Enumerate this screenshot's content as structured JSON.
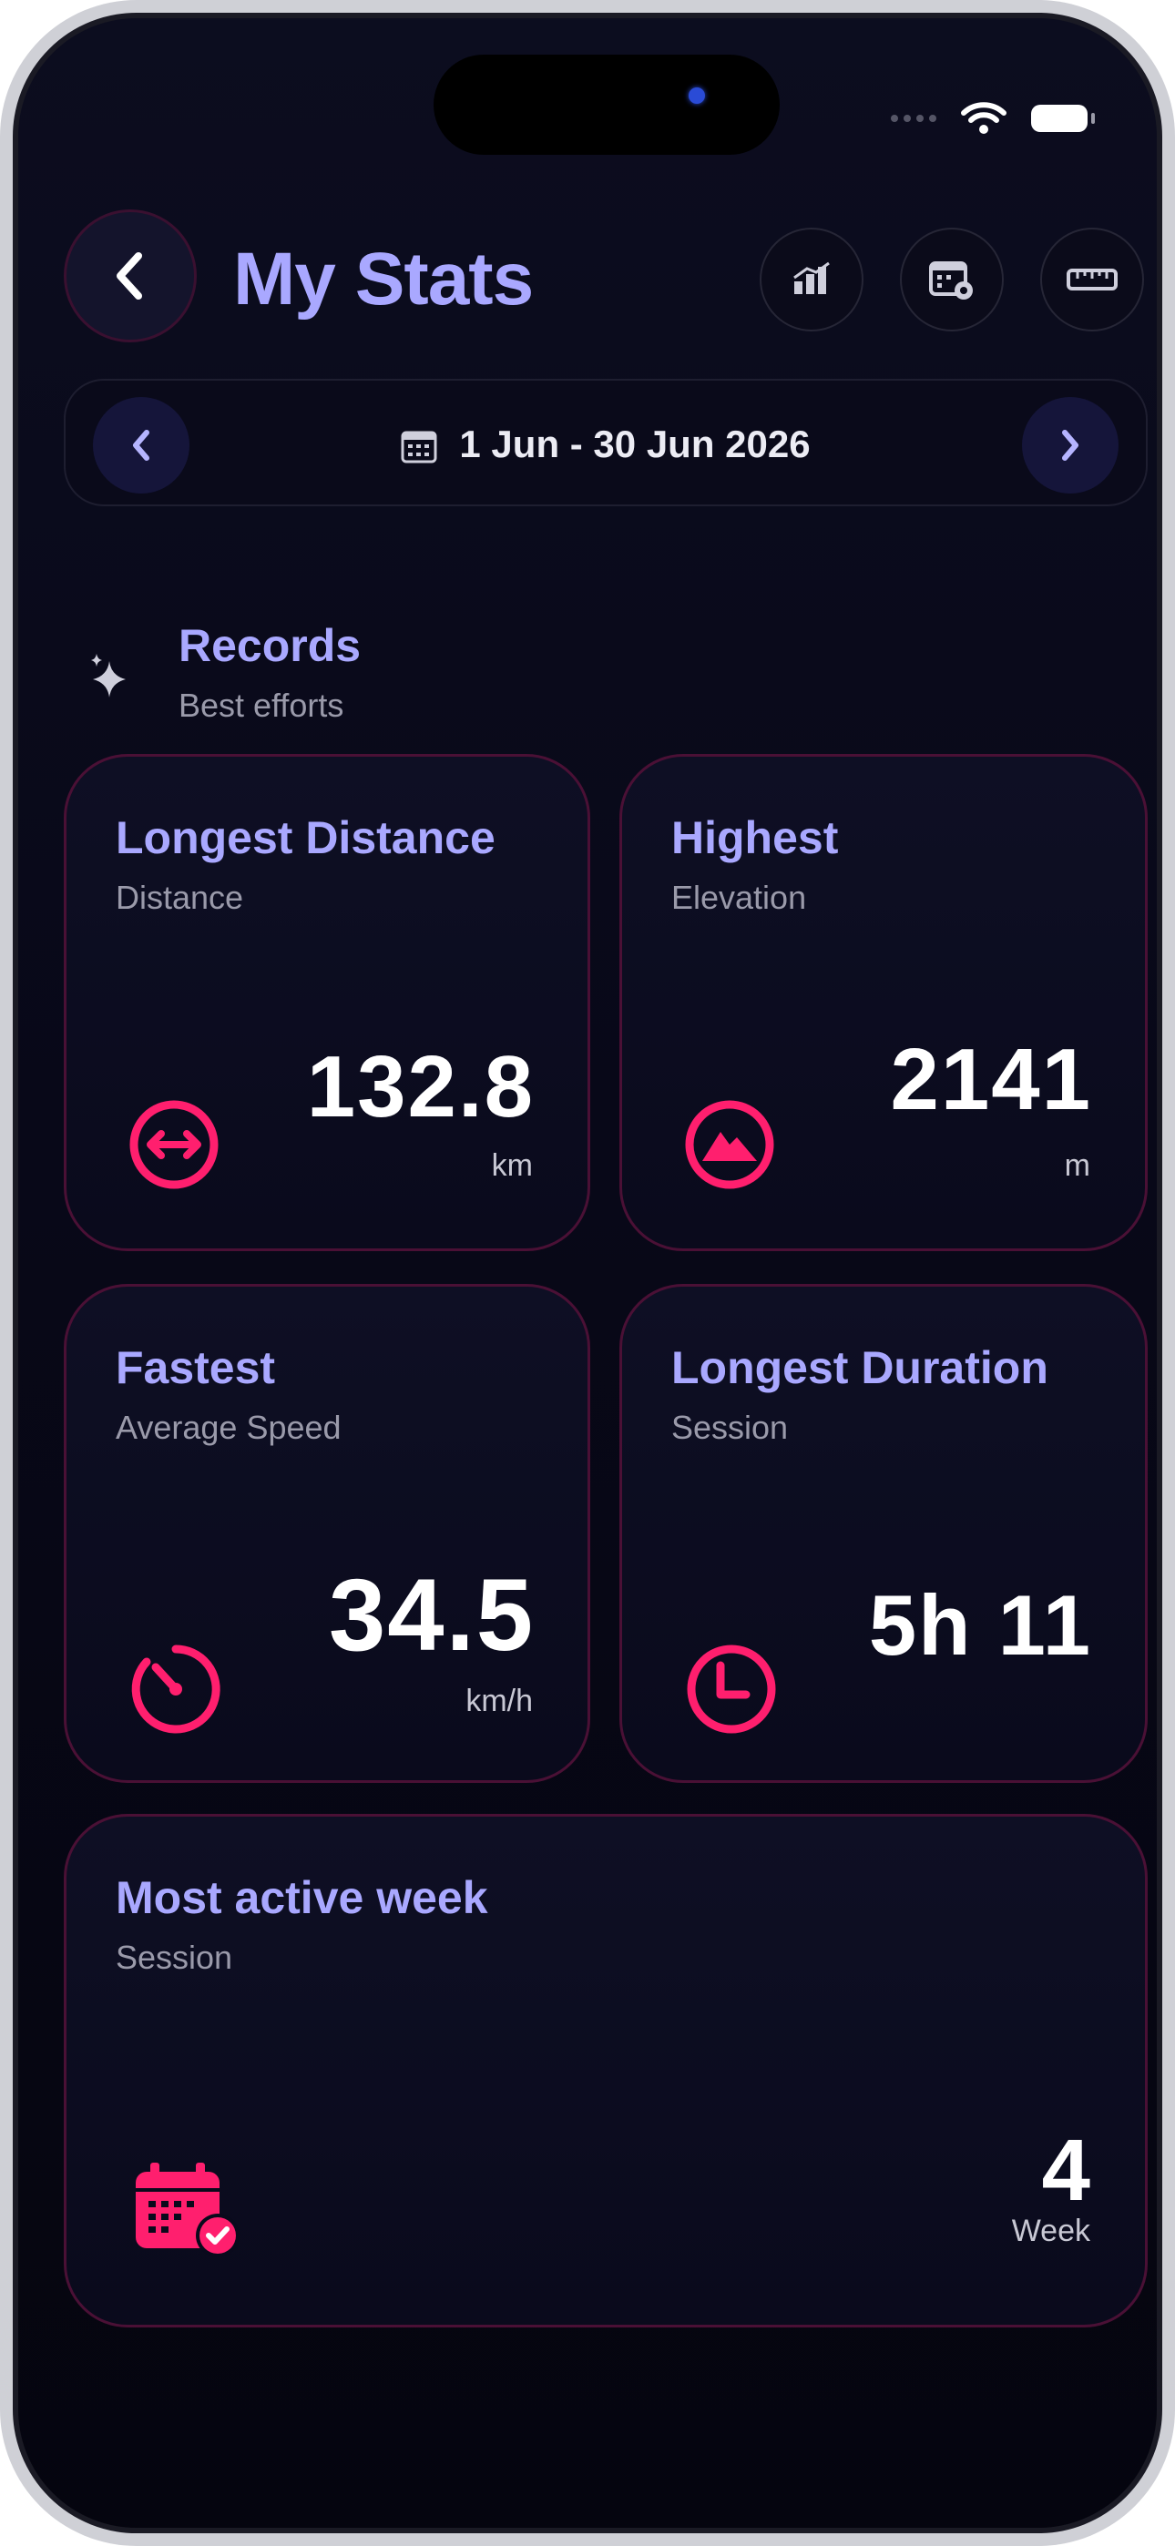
{
  "header": {
    "title": "My Stats"
  },
  "date_range": {
    "label": "1 Jun - 30 Jun 2026"
  },
  "records": {
    "title": "Records",
    "subtitle": "Best efforts"
  },
  "cards": [
    {
      "title": "Longest Distance",
      "subtitle": "Distance",
      "value": "132.8",
      "unit": "km",
      "icon": "distance-arrows-icon"
    },
    {
      "title": "Highest",
      "subtitle": "Elevation",
      "value": "2141",
      "unit": "m",
      "icon": "mountain-icon"
    },
    {
      "title": "Fastest",
      "subtitle": "Average Speed",
      "value": "34.5",
      "unit": "km/h",
      "icon": "speedometer-icon"
    },
    {
      "title": "Longest Duration",
      "subtitle": "Session",
      "value": "5h 11",
      "unit": "",
      "icon": "clock-icon"
    },
    {
      "title": "Most active week",
      "subtitle": "Session",
      "value": "4",
      "unit": "Week",
      "icon": "calendar-check-icon"
    }
  ],
  "colors": {
    "accent": "#a9a8ff",
    "icon_pink": "#ff1f6e",
    "card_border": "#4a1035",
    "background": "#080818"
  }
}
